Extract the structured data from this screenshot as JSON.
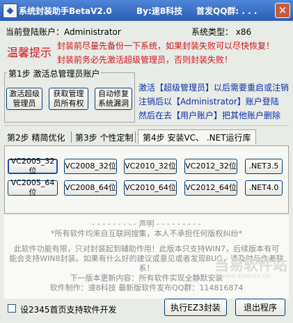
{
  "window": {
    "title": "系统封装助手BetaV2.0",
    "author": "By:速8科技",
    "qq_label": "首发QQ群: . . .",
    "close_glyph": "✕",
    "app_icon_glyph": "◆"
  },
  "header": {
    "account_label": "当前登陆账户：Administrator",
    "system_type_label": "系统类型：  x86"
  },
  "warning": {
    "title": "温馨提示",
    "line1": "封装前尽量先备份一下系统，如果封装失败可以尽快恢复！",
    "line2": "封装前务必先激活超级管理员，否则封装失败！"
  },
  "step1": {
    "legend": "第1步  激活总管理员账户",
    "buttons": [
      {
        "label": "激活超级\n管理员"
      },
      {
        "label": "获取管理\n员所有权"
      },
      {
        "label": "自动修复\n系统漏洞"
      }
    ],
    "hint_line1": "激活【超级管理员】以后需要重启或注销",
    "hint_line2": "注销后以【Administrator】账户登陆",
    "hint_line3": "然后在去【用户账户】把其他账户删除"
  },
  "tabs": [
    {
      "label": "第2步  精简优化",
      "active": false
    },
    {
      "label": "第3步  个性定制",
      "active": false
    },
    {
      "label": "第4步  安装VC、 .NET运行库",
      "active": true
    }
  ],
  "runtime_buttons": {
    "row1": [
      "VC2005_32位",
      "VC2008_32位",
      "VC2010_32位",
      "VC2012_32位",
      ".NET3.5"
    ],
    "row2": [
      "VC2005_64位",
      "VC2008_64位",
      "VC2010_64位",
      "VC2012_64位",
      ".NET4.0"
    ]
  },
  "notice": {
    "heading": "声明",
    "line1": "*所有软件均来自互联网搜集，本人不承担任何版权纠纷*",
    "line2": "此软件功能有限，只对封装起到辅助作用！此版本只支持WIN7，后续版本有可",
    "line3": "能会支持WIN8封装。如果有什么好的建议或意见或者发现BUG，请及时与作者联",
    "line4": "系！",
    "line5": "下一版本更新内容：所有软件实现全静默安装",
    "line6": "软件制作：速8科技       最新版软件发布QQ群：114816874"
  },
  "watermark": {
    "text": "当易软件站",
    "sub": "www.downza.cn"
  },
  "footer": {
    "checkbox_label": "设2345首页支持软件开发",
    "run_button": "执行EZ3封装",
    "exit_button": "退出程序"
  }
}
